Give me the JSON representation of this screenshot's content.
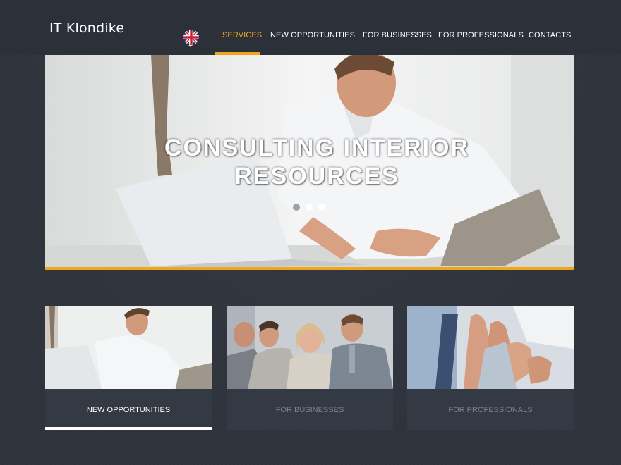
{
  "header": {
    "logo": "IT Klondike",
    "language_icon": "uk-flag-icon",
    "nav": [
      {
        "label": "SERVICES",
        "active": true
      },
      {
        "label": "NEW OPPORTUNITIES",
        "active": false
      },
      {
        "label": "FOR BUSINESSES",
        "active": false
      },
      {
        "label": "FOR PROFESSIONALS",
        "active": false
      },
      {
        "label": "CONTACTS",
        "active": false
      }
    ]
  },
  "hero": {
    "title_line1": "CONSULTING INTERIOR",
    "title_line2": "RESOURCES",
    "slides_total": 3,
    "active_slide": 2
  },
  "cards": [
    {
      "label": "NEW OPPORTUNITIES",
      "active": true
    },
    {
      "label": "FOR BUSINESSES",
      "active": false
    },
    {
      "label": "FOR PROFESSIONALS",
      "active": false
    }
  ],
  "colors": {
    "accent": "#f1a619",
    "background": "#2e333c",
    "header": "#2b3039",
    "card": "#343a44",
    "inactive_text": "#7e848e"
  }
}
